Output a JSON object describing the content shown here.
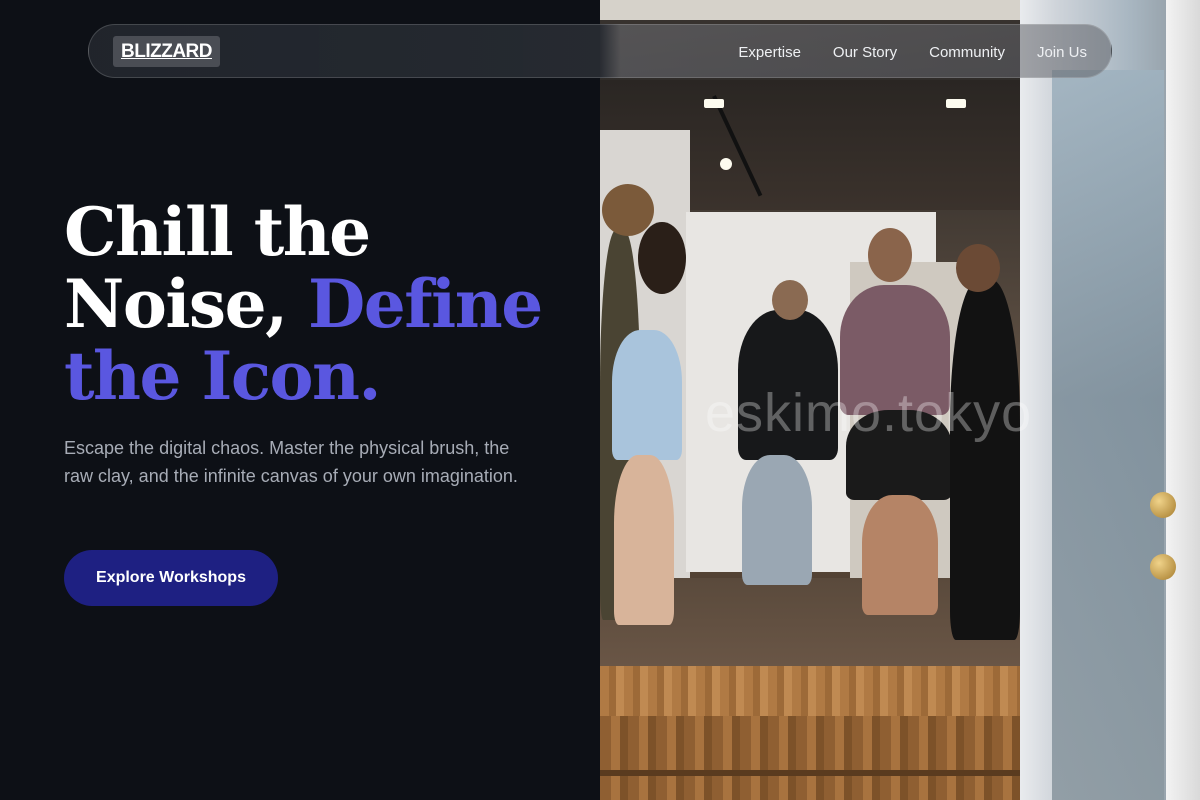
{
  "brand": {
    "logo_text": "BLIZZARD"
  },
  "nav": {
    "links": [
      "Expertise",
      "Our Story",
      "Community",
      "Join Us"
    ]
  },
  "hero": {
    "headline_line1": "Chill the",
    "headline_line2": "Noise,",
    "headline_accent": "Define the Icon.",
    "subtext": "Escape the digital chaos. Master the physical brush, the raw clay, and the infinite canvas of your own imagination.",
    "cta_label": "Explore Workshops",
    "accent_color": "#5a57e0",
    "cta_color": "#1e2082"
  },
  "photo": {
    "watermark": "eskimo.tokyo"
  }
}
